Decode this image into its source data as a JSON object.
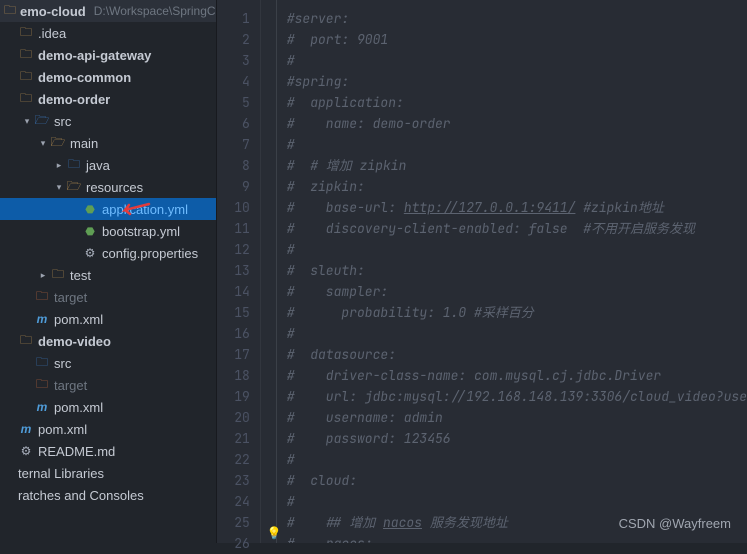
{
  "sidebar": {
    "project_root": "emo-cloud",
    "project_path": "D:\\Workspace\\SpringCloudProject",
    "nodes": [
      {
        "indent": 0,
        "chevron": "",
        "icon": "folder",
        "iconClass": "folder-icon",
        "label": ".idea"
      },
      {
        "indent": 0,
        "chevron": "",
        "icon": "folder",
        "iconClass": "folder-icon",
        "label": "demo-api-gateway",
        "bold": true
      },
      {
        "indent": 0,
        "chevron": "",
        "icon": "folder",
        "iconClass": "folder-icon",
        "label": "demo-common",
        "bold": true
      },
      {
        "indent": 0,
        "chevron": "",
        "icon": "folder",
        "iconClass": "folder-icon",
        "label": "demo-order",
        "bold": true
      },
      {
        "indent": 1,
        "chevron": "▾",
        "icon": "folder-open",
        "iconClass": "src-folder",
        "label": "src"
      },
      {
        "indent": 2,
        "chevron": "▾",
        "icon": "folder-open",
        "iconClass": "folder-open-icon",
        "label": "main"
      },
      {
        "indent": 3,
        "chevron": "▸",
        "icon": "folder",
        "iconClass": "src-folder",
        "label": "java"
      },
      {
        "indent": 3,
        "chevron": "▾",
        "icon": "folder-open",
        "iconClass": "res-folder",
        "label": "resources"
      },
      {
        "indent": 4,
        "chevron": "",
        "icon": "yml",
        "iconClass": "yml-icon",
        "label": "application.yml",
        "selected": true,
        "arrow": true
      },
      {
        "indent": 4,
        "chevron": "",
        "icon": "yml",
        "iconClass": "yml-icon",
        "label": "bootstrap.yml"
      },
      {
        "indent": 4,
        "chevron": "",
        "icon": "file",
        "iconClass": "file-icon",
        "label": "config.properties"
      },
      {
        "indent": 2,
        "chevron": "▸",
        "icon": "folder",
        "iconClass": "folder-icon",
        "label": "test"
      },
      {
        "indent": 1,
        "chevron": "",
        "icon": "folder",
        "iconClass": "target-icon",
        "label": "target",
        "muted": true
      },
      {
        "indent": 1,
        "chevron": "",
        "icon": "m",
        "iconClass": "m-icon",
        "label": "pom.xml"
      },
      {
        "indent": 0,
        "chevron": "",
        "icon": "folder",
        "iconClass": "folder-icon",
        "label": "demo-video",
        "bold": true
      },
      {
        "indent": 1,
        "chevron": "",
        "icon": "folder",
        "iconClass": "src-folder",
        "label": "src"
      },
      {
        "indent": 1,
        "chevron": "",
        "icon": "folder",
        "iconClass": "target-icon",
        "label": "target",
        "muted": true
      },
      {
        "indent": 1,
        "chevron": "",
        "icon": "m",
        "iconClass": "m-icon",
        "label": "pom.xml"
      },
      {
        "indent": 0,
        "chevron": "",
        "icon": "m",
        "iconClass": "m-icon",
        "label": "pom.xml"
      },
      {
        "indent": 0,
        "chevron": "",
        "icon": "file",
        "iconClass": "file-icon",
        "label": "README.md"
      },
      {
        "indent": 0,
        "chevron": "",
        "icon": "",
        "iconClass": "",
        "label": "ternal Libraries"
      },
      {
        "indent": 0,
        "chevron": "",
        "icon": "",
        "iconClass": "",
        "label": "ratches and Consoles"
      }
    ]
  },
  "editor": {
    "lines": [
      "#server:",
      "#  port: 9001",
      "#",
      "#spring:",
      "#  application:",
      "#    name: demo-order",
      "#",
      "#  # 增加 zipkin",
      "#  zipkin:",
      "#    base-url: http://127.0.0.1:9411/ #zipkin地址",
      "#    discovery-client-enabled: false  #不用开启服务发现",
      "#",
      "#  sleuth:",
      "#    sampler:",
      "#      probability: 1.0 #采样百分",
      "#",
      "#  datasource:",
      "#    driver-class-name: com.mysql.cj.jdbc.Driver",
      "#    url: jdbc:mysql://192.168.148.139:3306/cloud_video?use",
      "#    username: admin",
      "#    password: 123456",
      "#",
      "#  cloud:",
      "#",
      "#    ## 增加 nacos 服务发现地址",
      "#    nacos:"
    ]
  },
  "watermark": "CSDN @Wayfreem",
  "icons": {
    "folder": "🗀",
    "folder-open": "🗁",
    "yml": "⬣",
    "file": "⚙",
    "m": "m"
  }
}
